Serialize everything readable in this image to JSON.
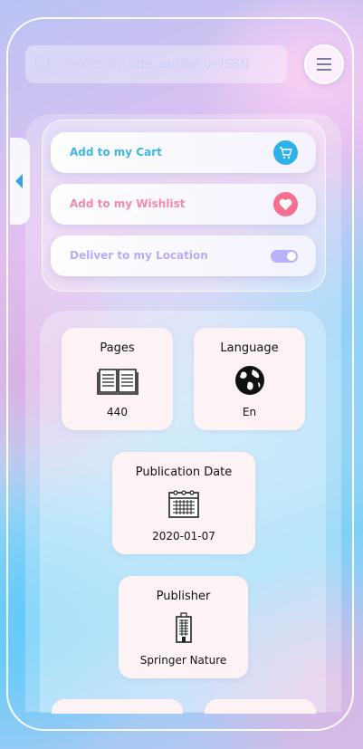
{
  "search": {
    "placeholder": "Search by title, author or ISBN",
    "icon": "search-icon"
  },
  "header": {
    "menu_icon": "hamburger-menu-icon"
  },
  "drawer": {
    "toggle_icon": "chevron-left-icon"
  },
  "actions": [
    {
      "label": "Add to my Cart",
      "color": "#3db8e4",
      "icon": "cart-icon",
      "icon_bg": "#2fb2e8"
    },
    {
      "label": "Add to my Wishlist",
      "color": "#f08bab",
      "icon": "heart-icon",
      "icon_bg": "#f5708f"
    },
    {
      "label": "Deliver to my Location",
      "color": "#b5aef5",
      "icon": "toggle-icon",
      "toggle_on": true
    }
  ],
  "details": [
    {
      "title": "Pages",
      "value": "440",
      "icon": "book-icon"
    },
    {
      "title": "Language",
      "value": "En",
      "icon": "globe-icon"
    },
    {
      "title": "Publication Date",
      "value": "2020-01-07",
      "icon": "calendar-icon"
    },
    {
      "title": "Publisher",
      "value": "Springer Nature",
      "icon": "building-icon"
    }
  ]
}
